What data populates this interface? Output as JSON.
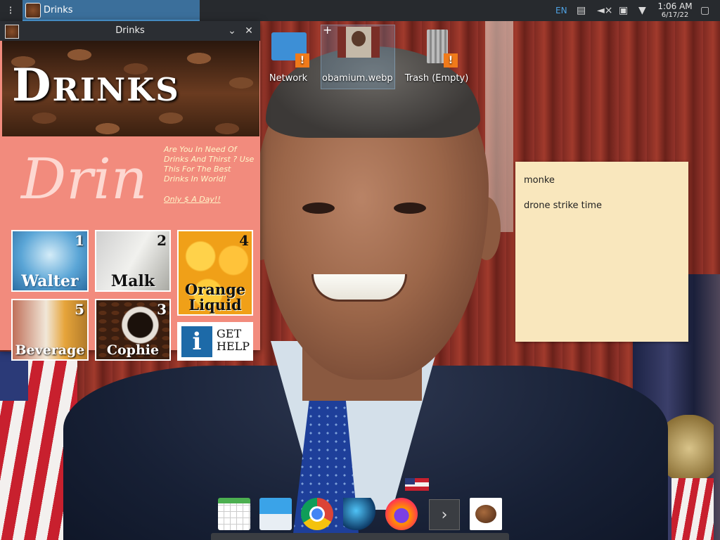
{
  "taskbar": {
    "active_task_label": "Drinks",
    "language": "EN",
    "clock_time": "1:06 AM",
    "clock_date": "6/17/22"
  },
  "desktop_icons": [
    {
      "label": "Network",
      "icon": "folder-icon",
      "badge": "!"
    },
    {
      "label": "obamium.webp",
      "icon": "image-file-icon"
    },
    {
      "label": "Trash (Empty)",
      "icon": "trash-icon",
      "badge": "!"
    }
  ],
  "drinks_window": {
    "title": "Drinks",
    "banner_title": "Drinks",
    "big_text": "Drin",
    "tagline": "Are You In Need Of Drinks And Thirst ? Use This For The Best Drinks In World!",
    "price": "Only $ A Day!!",
    "tiles": [
      {
        "num": "1",
        "name": "Walter"
      },
      {
        "num": "2",
        "name": "Malk"
      },
      {
        "num": "4",
        "name": "Orange Liquid"
      },
      {
        "num": "5",
        "name": "Beverage"
      },
      {
        "num": "3",
        "name": "Cophie"
      }
    ],
    "help": {
      "icon": "i",
      "line1": "GET",
      "line2": "HELP"
    }
  },
  "sticky_note": {
    "line1": "monke",
    "line2": "drone strike time"
  },
  "dock": {
    "items": [
      "calendar-icon",
      "mail-icon",
      "chrome-icon",
      "bird-app-icon",
      "firefox-icon",
      "more-icon",
      "coffee-bean-icon"
    ],
    "more_glyph": "›"
  },
  "colors": {
    "accent": "#4fa2e3",
    "drinks_bg": "#f28b7d",
    "note_bg": "#f9e7bd",
    "badge": "#f07a1a"
  }
}
